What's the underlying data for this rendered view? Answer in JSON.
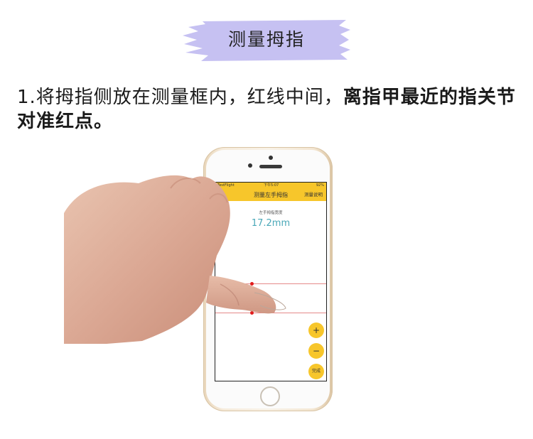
{
  "title": "测量拇指",
  "instruction": {
    "normal": "1.将拇指侧放在测量框内，红线中间，",
    "bold": "离指甲最近的指关节对准红点。"
  },
  "app": {
    "status_bar": {
      "carrier": "TestFlight",
      "time": "下午5:07",
      "battery": "92%"
    },
    "nav_title": "测量左手拇指",
    "nav_right": "测量说明",
    "measure_label": "左手拇指宽度",
    "measure_value": "17.2mm",
    "buttons": {
      "plus": "+",
      "minus": "−",
      "done": "完成"
    }
  },
  "colors": {
    "banner": "#c6c1f2",
    "accent_yellow": "#f7c62b",
    "value_teal": "#4aa8b8",
    "guide_red": "#e58a8a"
  }
}
